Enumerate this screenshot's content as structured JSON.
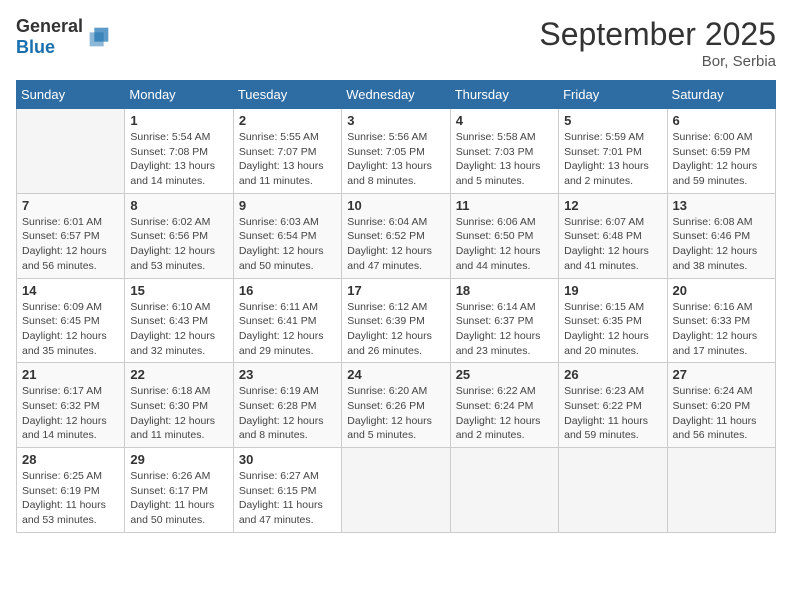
{
  "header": {
    "logo_general": "General",
    "logo_blue": "Blue",
    "title": "September 2025",
    "location": "Bor, Serbia"
  },
  "weekdays": [
    "Sunday",
    "Monday",
    "Tuesday",
    "Wednesday",
    "Thursday",
    "Friday",
    "Saturday"
  ],
  "weeks": [
    [
      {
        "day": "",
        "sunrise": "",
        "sunset": "",
        "daylight": ""
      },
      {
        "day": "1",
        "sunrise": "Sunrise: 5:54 AM",
        "sunset": "Sunset: 7:08 PM",
        "daylight": "Daylight: 13 hours and 14 minutes."
      },
      {
        "day": "2",
        "sunrise": "Sunrise: 5:55 AM",
        "sunset": "Sunset: 7:07 PM",
        "daylight": "Daylight: 13 hours and 11 minutes."
      },
      {
        "day": "3",
        "sunrise": "Sunrise: 5:56 AM",
        "sunset": "Sunset: 7:05 PM",
        "daylight": "Daylight: 13 hours and 8 minutes."
      },
      {
        "day": "4",
        "sunrise": "Sunrise: 5:58 AM",
        "sunset": "Sunset: 7:03 PM",
        "daylight": "Daylight: 13 hours and 5 minutes."
      },
      {
        "day": "5",
        "sunrise": "Sunrise: 5:59 AM",
        "sunset": "Sunset: 7:01 PM",
        "daylight": "Daylight: 13 hours and 2 minutes."
      },
      {
        "day": "6",
        "sunrise": "Sunrise: 6:00 AM",
        "sunset": "Sunset: 6:59 PM",
        "daylight": "Daylight: 12 hours and 59 minutes."
      }
    ],
    [
      {
        "day": "7",
        "sunrise": "Sunrise: 6:01 AM",
        "sunset": "Sunset: 6:57 PM",
        "daylight": "Daylight: 12 hours and 56 minutes."
      },
      {
        "day": "8",
        "sunrise": "Sunrise: 6:02 AM",
        "sunset": "Sunset: 6:56 PM",
        "daylight": "Daylight: 12 hours and 53 minutes."
      },
      {
        "day": "9",
        "sunrise": "Sunrise: 6:03 AM",
        "sunset": "Sunset: 6:54 PM",
        "daylight": "Daylight: 12 hours and 50 minutes."
      },
      {
        "day": "10",
        "sunrise": "Sunrise: 6:04 AM",
        "sunset": "Sunset: 6:52 PM",
        "daylight": "Daylight: 12 hours and 47 minutes."
      },
      {
        "day": "11",
        "sunrise": "Sunrise: 6:06 AM",
        "sunset": "Sunset: 6:50 PM",
        "daylight": "Daylight: 12 hours and 44 minutes."
      },
      {
        "day": "12",
        "sunrise": "Sunrise: 6:07 AM",
        "sunset": "Sunset: 6:48 PM",
        "daylight": "Daylight: 12 hours and 41 minutes."
      },
      {
        "day": "13",
        "sunrise": "Sunrise: 6:08 AM",
        "sunset": "Sunset: 6:46 PM",
        "daylight": "Daylight: 12 hours and 38 minutes."
      }
    ],
    [
      {
        "day": "14",
        "sunrise": "Sunrise: 6:09 AM",
        "sunset": "Sunset: 6:45 PM",
        "daylight": "Daylight: 12 hours and 35 minutes."
      },
      {
        "day": "15",
        "sunrise": "Sunrise: 6:10 AM",
        "sunset": "Sunset: 6:43 PM",
        "daylight": "Daylight: 12 hours and 32 minutes."
      },
      {
        "day": "16",
        "sunrise": "Sunrise: 6:11 AM",
        "sunset": "Sunset: 6:41 PM",
        "daylight": "Daylight: 12 hours and 29 minutes."
      },
      {
        "day": "17",
        "sunrise": "Sunrise: 6:12 AM",
        "sunset": "Sunset: 6:39 PM",
        "daylight": "Daylight: 12 hours and 26 minutes."
      },
      {
        "day": "18",
        "sunrise": "Sunrise: 6:14 AM",
        "sunset": "Sunset: 6:37 PM",
        "daylight": "Daylight: 12 hours and 23 minutes."
      },
      {
        "day": "19",
        "sunrise": "Sunrise: 6:15 AM",
        "sunset": "Sunset: 6:35 PM",
        "daylight": "Daylight: 12 hours and 20 minutes."
      },
      {
        "day": "20",
        "sunrise": "Sunrise: 6:16 AM",
        "sunset": "Sunset: 6:33 PM",
        "daylight": "Daylight: 12 hours and 17 minutes."
      }
    ],
    [
      {
        "day": "21",
        "sunrise": "Sunrise: 6:17 AM",
        "sunset": "Sunset: 6:32 PM",
        "daylight": "Daylight: 12 hours and 14 minutes."
      },
      {
        "day": "22",
        "sunrise": "Sunrise: 6:18 AM",
        "sunset": "Sunset: 6:30 PM",
        "daylight": "Daylight: 12 hours and 11 minutes."
      },
      {
        "day": "23",
        "sunrise": "Sunrise: 6:19 AM",
        "sunset": "Sunset: 6:28 PM",
        "daylight": "Daylight: 12 hours and 8 minutes."
      },
      {
        "day": "24",
        "sunrise": "Sunrise: 6:20 AM",
        "sunset": "Sunset: 6:26 PM",
        "daylight": "Daylight: 12 hours and 5 minutes."
      },
      {
        "day": "25",
        "sunrise": "Sunrise: 6:22 AM",
        "sunset": "Sunset: 6:24 PM",
        "daylight": "Daylight: 12 hours and 2 minutes."
      },
      {
        "day": "26",
        "sunrise": "Sunrise: 6:23 AM",
        "sunset": "Sunset: 6:22 PM",
        "daylight": "Daylight: 11 hours and 59 minutes."
      },
      {
        "day": "27",
        "sunrise": "Sunrise: 6:24 AM",
        "sunset": "Sunset: 6:20 PM",
        "daylight": "Daylight: 11 hours and 56 minutes."
      }
    ],
    [
      {
        "day": "28",
        "sunrise": "Sunrise: 6:25 AM",
        "sunset": "Sunset: 6:19 PM",
        "daylight": "Daylight: 11 hours and 53 minutes."
      },
      {
        "day": "29",
        "sunrise": "Sunrise: 6:26 AM",
        "sunset": "Sunset: 6:17 PM",
        "daylight": "Daylight: 11 hours and 50 minutes."
      },
      {
        "day": "30",
        "sunrise": "Sunrise: 6:27 AM",
        "sunset": "Sunset: 6:15 PM",
        "daylight": "Daylight: 11 hours and 47 minutes."
      },
      {
        "day": "",
        "sunrise": "",
        "sunset": "",
        "daylight": ""
      },
      {
        "day": "",
        "sunrise": "",
        "sunset": "",
        "daylight": ""
      },
      {
        "day": "",
        "sunrise": "",
        "sunset": "",
        "daylight": ""
      },
      {
        "day": "",
        "sunrise": "",
        "sunset": "",
        "daylight": ""
      }
    ]
  ]
}
